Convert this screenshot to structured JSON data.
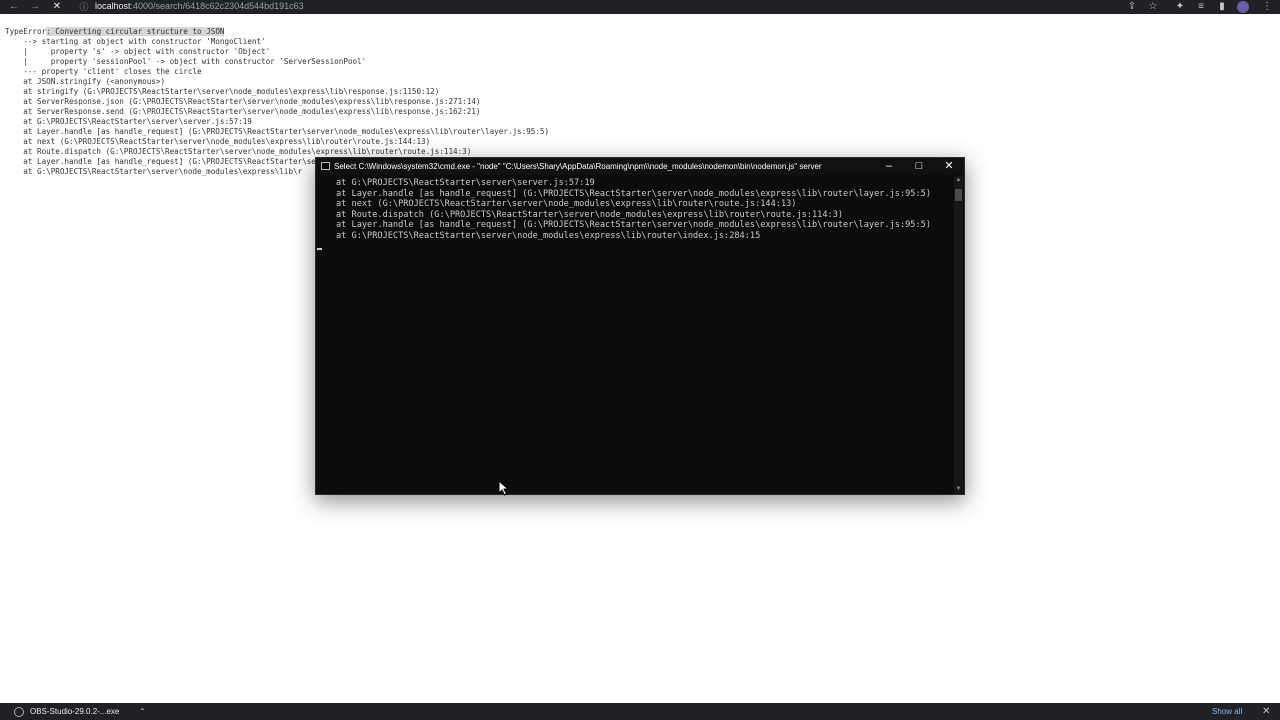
{
  "browser": {
    "url_host": "localhost",
    "url_rest": ":4000/search/6418c62c2304d544bd191c63",
    "icons": [
      "back-arrow-icon",
      "forward-arrow-icon",
      "stop-icon",
      "lock-icon",
      "share-icon",
      "star-icon",
      "extensions-icon",
      "reading-list-icon",
      "sidebar-icon",
      "avatar",
      "menu-icon"
    ]
  },
  "page": {
    "error_prefix": "TypeError",
    "error_message": ": Converting circular structure to JSON",
    "lines": [
      "    --> starting at object with constructor 'MongoClient'",
      "    |     property 's' -> object with constructor 'Object'",
      "    |     property 'sessionPool' -> object with constructor 'ServerSessionPool'",
      "    --- property 'client' closes the circle",
      "    at JSON.stringify (<anonymous>)",
      "    at stringify (G:\\PROJECTS\\ReactStarter\\server\\node_modules\\express\\lib\\response.js:1150:12)",
      "    at ServerResponse.json (G:\\PROJECTS\\ReactStarter\\server\\node_modules\\express\\lib\\response.js:271:14)",
      "    at ServerResponse.send (G:\\PROJECTS\\ReactStarter\\server\\node_modules\\express\\lib\\response.js:162:21)",
      "    at G:\\PROJECTS\\ReactStarter\\server\\server.js:57:19",
      "    at Layer.handle [as handle_request] (G:\\PROJECTS\\ReactStarter\\server\\node_modules\\express\\lib\\router\\layer.js:95:5)",
      "    at next (G:\\PROJECTS\\ReactStarter\\server\\node_modules\\express\\lib\\router\\route.js:144:13)",
      "    at Route.dispatch (G:\\PROJECTS\\ReactStarter\\server\\node_modules\\express\\lib\\router\\route.js:114:3)",
      "    at Layer.handle [as handle_request] (G:\\PROJECTS\\ReactStarter\\server\\",
      "    at G:\\PROJECTS\\ReactStarter\\server\\node_modules\\express\\lib\\r"
    ]
  },
  "console": {
    "title": "Select C:\\Windows\\system32\\cmd.exe - \"node\"  \"C:\\Users\\Shary\\AppData\\Roaming\\npm\\\\node_modules\\nodemon\\bin\\nodemon.js\" server",
    "lines": [
      "at G:\\PROJECTS\\ReactStarter\\server\\server.js:57:19",
      "at Layer.handle [as handle_request] (G:\\PROJECTS\\ReactStarter\\server\\node_modules\\express\\lib\\router\\layer.js:95:5)",
      "at next (G:\\PROJECTS\\ReactStarter\\server\\node_modules\\express\\lib\\router\\route.js:144:13)",
      "at Route.dispatch (G:\\PROJECTS\\ReactStarter\\server\\node_modules\\express\\lib\\router\\route.js:114:3)",
      "at Layer.handle [as handle_request] (G:\\PROJECTS\\ReactStarter\\server\\node_modules\\express\\lib\\router\\layer.js:95:5)",
      "at G:\\PROJECTS\\ReactStarter\\server\\node_modules\\express\\lib\\router\\index.js:284:15"
    ]
  },
  "downloads": {
    "item_label": "OBS-Studio-29.0.2-...exe",
    "show_all": "Show all"
  },
  "colors": {
    "browser_chrome": "#202124",
    "console_bg": "#0c0c0c",
    "console_text": "#cccccc",
    "link_blue": "#8ab4f8"
  }
}
